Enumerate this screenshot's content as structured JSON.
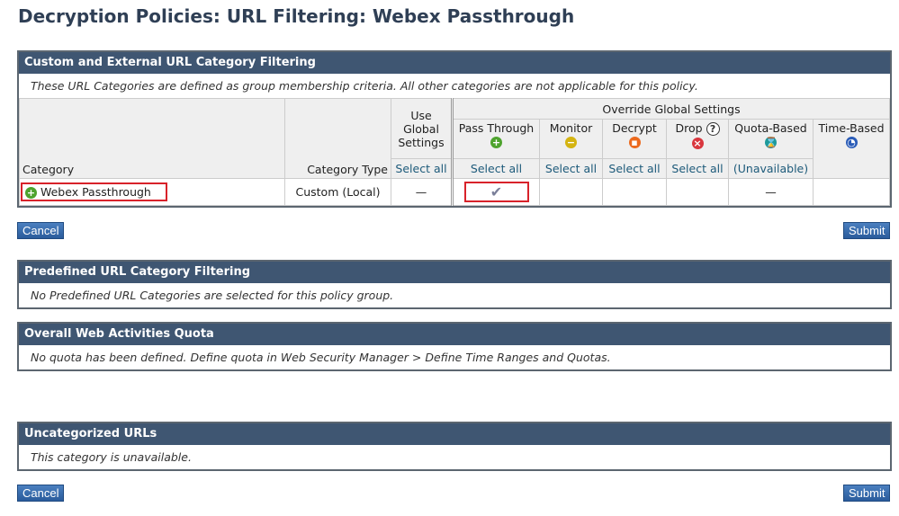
{
  "title": "Decryption Policies: URL Filtering: Webex Passthrough",
  "custom": {
    "header": "Custom and External URL Category Filtering",
    "note": "These URL Categories are defined as group membership criteria. All other categories are not applicable for this policy.",
    "col_category": "Category",
    "col_type": "Category Type",
    "col_global": "Use Global Settings",
    "col_override": "Override Global Settings",
    "actions": [
      {
        "label": "Pass Through",
        "select": "Select all"
      },
      {
        "label": "Monitor",
        "select": "Select all"
      },
      {
        "label": "Decrypt",
        "select": "Select all"
      },
      {
        "label": "Drop",
        "select": "Select all"
      },
      {
        "label": "Quota-Based",
        "select": "(Unavailable)"
      },
      {
        "label": "Time-Based"
      }
    ],
    "global_select": "Select all",
    "row": {
      "name": "Webex Passthrough",
      "type": "Custom (Local)",
      "global": "—",
      "quota": "—"
    }
  },
  "buttons": {
    "cancel": "Cancel",
    "submit": "Submit"
  },
  "predefined": {
    "header": "Predefined URL Category Filtering",
    "note": "No Predefined URL Categories are selected for this policy group."
  },
  "quota": {
    "header": "Overall Web Activities Quota",
    "note": "No quota has been defined. Define quota in Web Security Manager > Define Time Ranges and Quotas."
  },
  "uncat": {
    "header": "Uncategorized URLs",
    "note": "This category is unavailable."
  }
}
